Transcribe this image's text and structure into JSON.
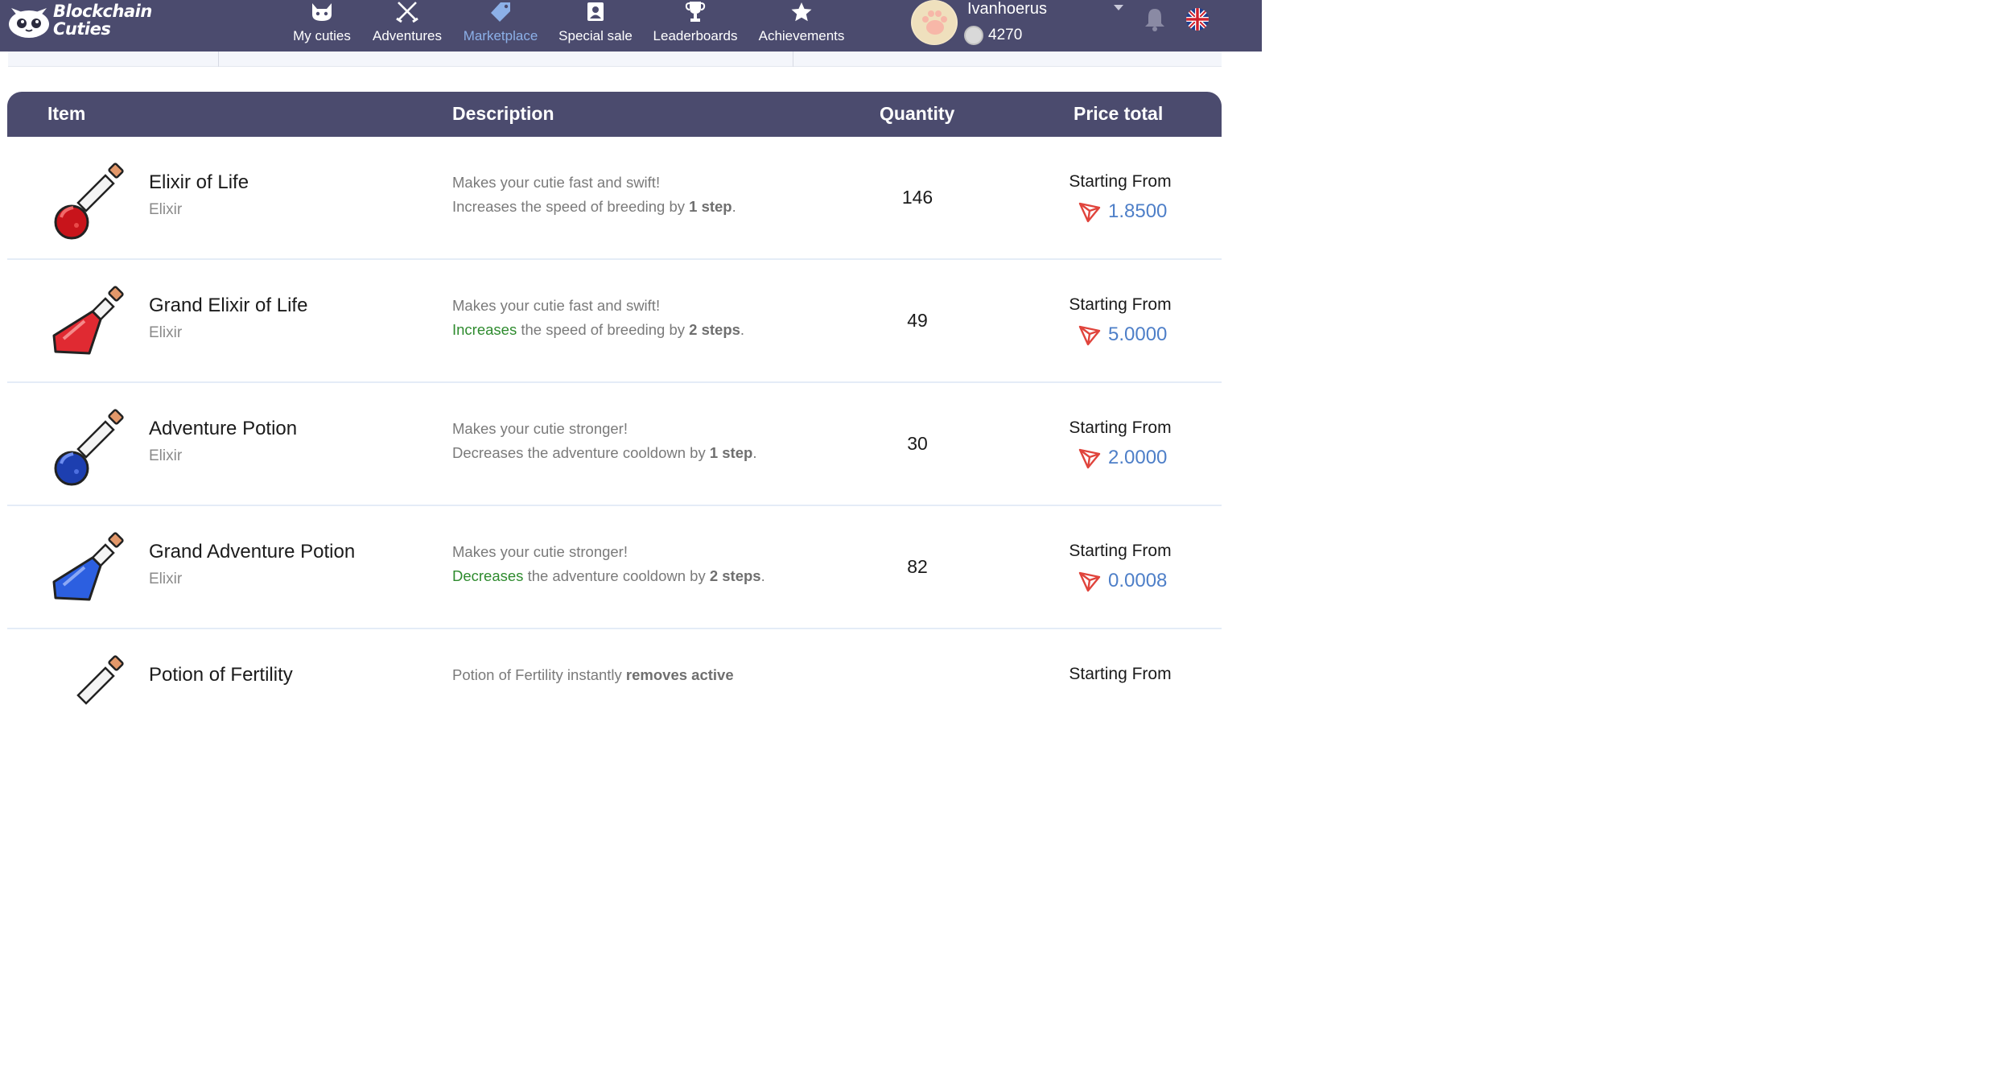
{
  "app": {
    "logo_line1": "Blockchain",
    "logo_line2": "Cuties"
  },
  "nav": [
    {
      "label": "My cuties",
      "icon": "cat-face-icon",
      "active": false
    },
    {
      "label": "Adventures",
      "icon": "crossed-swords-icon",
      "active": false
    },
    {
      "label": "Marketplace",
      "icon": "price-tag-icon",
      "active": true
    },
    {
      "label": "Special sale",
      "icon": "badge-card-icon",
      "active": false
    },
    {
      "label": "Leaderboards",
      "icon": "trophy-icon",
      "active": false
    },
    {
      "label": "Achievements",
      "icon": "star-icon",
      "active": false
    }
  ],
  "user": {
    "name": "Ivanhoerus",
    "coins": "4270"
  },
  "colors": {
    "header_bg": "#4b4b6e",
    "active_nav": "#8cb0e8",
    "price_blue": "#4e7fc8",
    "highlight_green": "#2e8b2e",
    "tron_red": "#e0443c"
  },
  "table": {
    "headers": {
      "item": "Item",
      "description": "Description",
      "quantity": "Quantity",
      "price": "Price total"
    },
    "rows": [
      {
        "name": "Elixir of Life",
        "type": "Elixir",
        "desc1": "Makes your cutie fast and swift!",
        "desc2_lead": "",
        "desc2_text": "Increases the speed of breeding by ",
        "desc2_bold": "1 step",
        "desc2_end": ".",
        "quantity": "146",
        "price_label": "Starting From",
        "price": "1.8500",
        "potion": "red-round"
      },
      {
        "name": "Grand Elixir of Life",
        "type": "Elixir",
        "desc1": "Makes your cutie fast and swift!",
        "desc2_lead": "Increases",
        "desc2_text": " the speed of breeding by ",
        "desc2_bold": "2 steps",
        "desc2_end": ".",
        "quantity": "49",
        "price_label": "Starting From",
        "price": "5.0000",
        "potion": "red-flask"
      },
      {
        "name": "Adventure Potion",
        "type": "Elixir",
        "desc1": "Makes your cutie stronger!",
        "desc2_lead": "",
        "desc2_text": "Decreases the adventure cooldown by ",
        "desc2_bold": "1 step",
        "desc2_end": ".",
        "quantity": "30",
        "price_label": "Starting From",
        "price": "2.0000",
        "potion": "blue-round"
      },
      {
        "name": "Grand Adventure Potion",
        "type": "Elixir",
        "desc1": "Makes your cutie stronger!",
        "desc2_lead": "Decreases",
        "desc2_text": " the adventure cooldown by ",
        "desc2_bold": "2 steps",
        "desc2_end": ".",
        "quantity": "82",
        "price_label": "Starting From",
        "price": "0.0008",
        "potion": "blue-flask"
      },
      {
        "name": "Potion of Fertility",
        "type": "",
        "desc1": "Potion of Fertility instantly ",
        "desc1_bold": "removes active",
        "quantity": "",
        "price_label": "Starting From",
        "price": "",
        "potion": "red-round"
      }
    ]
  }
}
